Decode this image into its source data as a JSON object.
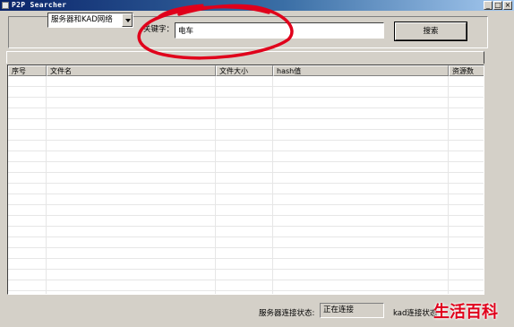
{
  "window": {
    "title": "P2P Searcher",
    "controls": {
      "minimize": "_",
      "maximize": "□",
      "close": "×"
    }
  },
  "search": {
    "network_select": "服务器和KAD网络",
    "keyword_label": "关键字：",
    "keyword_value": "电车",
    "search_button": "搜索"
  },
  "results": {
    "columns": [
      "序号",
      "文件名",
      "文件大小",
      "hash值",
      "资源数"
    ],
    "rows": []
  },
  "status": {
    "server_label": "服务器连接状态:",
    "server_value": "正在连接",
    "kad_label": "kad连接状态"
  },
  "watermark": "生活百科",
  "colors": {
    "window_bg": "#d4d0c8",
    "titlebar_start": "#0a246a",
    "titlebar_end": "#a6caf0",
    "annotation": "#e0001b"
  }
}
